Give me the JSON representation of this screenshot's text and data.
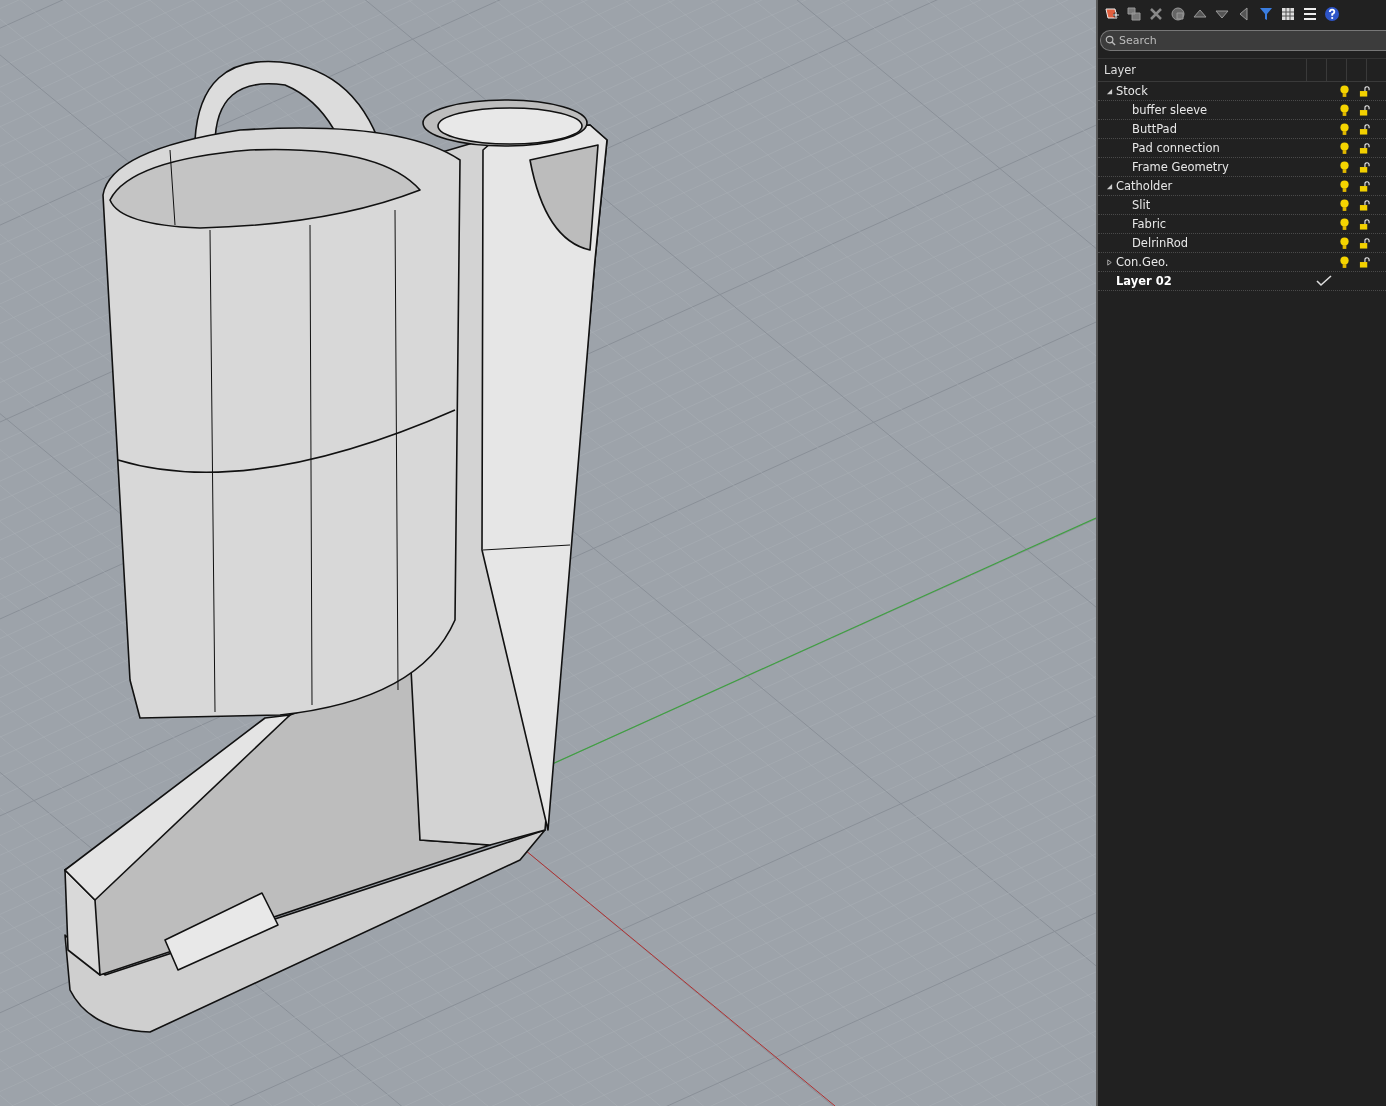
{
  "layers_panel": {
    "search": {
      "placeholder": "Search"
    },
    "columns": [
      "Layer"
    ],
    "layers": [
      {
        "name": "Stock",
        "expanded": true,
        "current": false,
        "visible": true,
        "locked": false,
        "children": [
          {
            "name": "buffer sleeve",
            "current": false,
            "visible": true,
            "locked": false
          },
          {
            "name": "ButtPad",
            "current": false,
            "visible": true,
            "locked": false
          },
          {
            "name": "Pad connection",
            "current": false,
            "visible": true,
            "locked": false
          },
          {
            "name": "Frame Geometry",
            "current": false,
            "visible": true,
            "locked": false
          }
        ]
      },
      {
        "name": "Catholder",
        "expanded": true,
        "current": false,
        "visible": true,
        "locked": false,
        "children": [
          {
            "name": "Slit",
            "current": false,
            "visible": true,
            "locked": false
          },
          {
            "name": "Fabric",
            "current": false,
            "visible": true,
            "locked": false
          },
          {
            "name": "DelrinRod",
            "current": false,
            "visible": true,
            "locked": false
          }
        ]
      },
      {
        "name": "Con.Geo.",
        "expanded": false,
        "current": false,
        "visible": true,
        "locked": false
      },
      {
        "name": "Layer 02",
        "current": true
      }
    ]
  }
}
